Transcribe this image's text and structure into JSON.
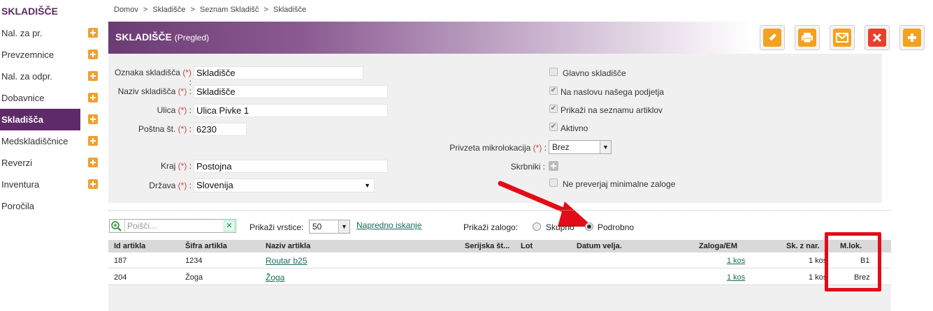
{
  "sidebar": {
    "title": "SKLADIŠČE",
    "items": [
      {
        "label": "Nal. za pr.",
        "plus": true
      },
      {
        "label": "Prevzemnice",
        "plus": true
      },
      {
        "label": "Nal. za odpr.",
        "plus": true
      },
      {
        "label": "Dobavnice",
        "plus": true
      },
      {
        "label": "Skladišča",
        "plus": true,
        "active": true
      },
      {
        "label": "Medskladiščnice",
        "plus": true
      },
      {
        "label": "Reverzi",
        "plus": true
      },
      {
        "label": "Inventura",
        "plus": true
      },
      {
        "label": "Poročila",
        "plus": false
      }
    ]
  },
  "breadcrumb": [
    "Domov",
    ">",
    "Skladišče",
    ">",
    "Seznam Skladišč",
    ">",
    "Skladišče"
  ],
  "header": {
    "title": "SKLADIŠČE",
    "subtitle": "(Pregled)"
  },
  "toolbar": {
    "icons": [
      "edit-icon",
      "print-icon",
      "mail-icon",
      "delete-icon",
      "add-icon"
    ],
    "colors": {
      "edit": "#f2a21e",
      "print": "#f2a21e",
      "mail": "#f2a21e",
      "delete": "#e8402a",
      "add": "#f2a21e"
    }
  },
  "form": {
    "required_marker": "(*)",
    "oznaka_label": "Oznaka skladišča",
    "oznaka_value": "Skladišče",
    "naziv_label": "Naziv skladišča",
    "naziv_value": "Skladišče",
    "ulica_label": "Ulica",
    "ulica_value": "Ulica Pivke 1",
    "postna_label": "Poštna št.",
    "postna_value": "6230",
    "kraj_label": "Kraj",
    "kraj_value": "Postojna",
    "drzava_label": "Država",
    "drzava_value": "Slovenija",
    "glavno_label": "Glavno skladišče",
    "naslov_label": "Na naslovu našega podjetja",
    "prikazi_label": "Prikaži na seznamu artiklov",
    "aktivno_label": "Aktivno",
    "mikrolok_label": "Privzeta mikrolokacija",
    "mikrolok_value": "Brez",
    "skrbniki_label": "Skrbniki :",
    "preverjaj_label": "Ne preverjaj minimalne zaloge"
  },
  "list": {
    "search_placeholder": "Poišči...",
    "rows_label": "Prikaži vrstice:",
    "rows_value": "50",
    "advanced_link": "Napredno iskanje",
    "stock_label": "Prikaži zalogo:",
    "radio_total": "Skupno",
    "radio_detail": "Podrobno",
    "columns": [
      "Id artikla",
      "Šifra artikla",
      "Naziv artikla",
      "Serijska št...",
      "Lot",
      "Datum velja.",
      "Zaloga/EM",
      "Sk. z nar.",
      "M.lok."
    ],
    "rows": [
      {
        "id": "187",
        "sifra": "1234",
        "naziv": "Routar b25",
        "zaloga": "1 kos",
        "sknar": "1 kos",
        "mlok": "B1"
      },
      {
        "id": "204",
        "sifra": "Žoga",
        "naziv": "Žoga",
        "zaloga": "1 kos",
        "sknar": "1 kos",
        "mlok": "Brez"
      }
    ]
  }
}
